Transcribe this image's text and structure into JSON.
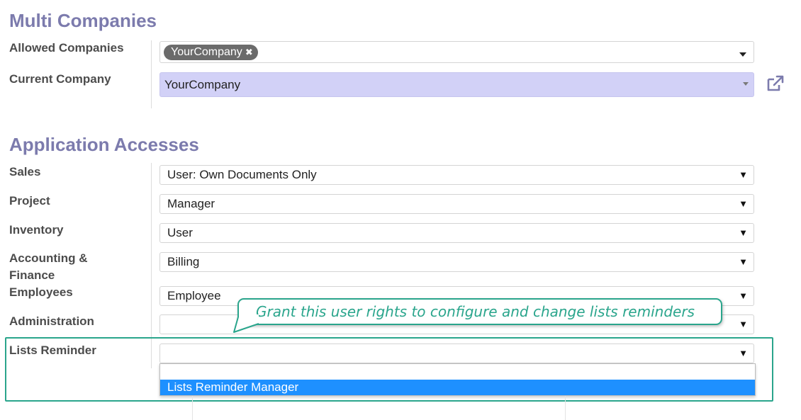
{
  "multi_companies": {
    "heading": "Multi Companies",
    "allowed_label": "Allowed Companies",
    "allowed_tags": [
      "YourCompany"
    ],
    "tag_remove_glyph": "✖",
    "current_label": "Current Company",
    "current_value": "YourCompany"
  },
  "app_access": {
    "heading": "Application Accesses",
    "rows": [
      {
        "label": "Sales",
        "value": "User: Own Documents Only"
      },
      {
        "label": "Project",
        "value": "Manager"
      },
      {
        "label": "Inventory",
        "value": "User"
      },
      {
        "label": "Accounting & Finance",
        "value": "Billing"
      },
      {
        "label": "Employees",
        "value": "Employee"
      },
      {
        "label": "Administration",
        "value": ""
      },
      {
        "label": "Lists Reminder",
        "value": ""
      }
    ]
  },
  "tooltip": "Grant this user rights to configure and change lists reminders",
  "dropdown": {
    "options": [
      "",
      "Lists Reminder Manager"
    ],
    "highlighted": "Lists Reminder Manager"
  },
  "icons": {
    "external_link": "external-link-icon",
    "select_arrow": "▼"
  },
  "colors": {
    "heading": "#7c7bad",
    "current_company_bg": "#d2d1f7",
    "highlight": "#2aa58c",
    "selected_option": "#1e90ff"
  }
}
